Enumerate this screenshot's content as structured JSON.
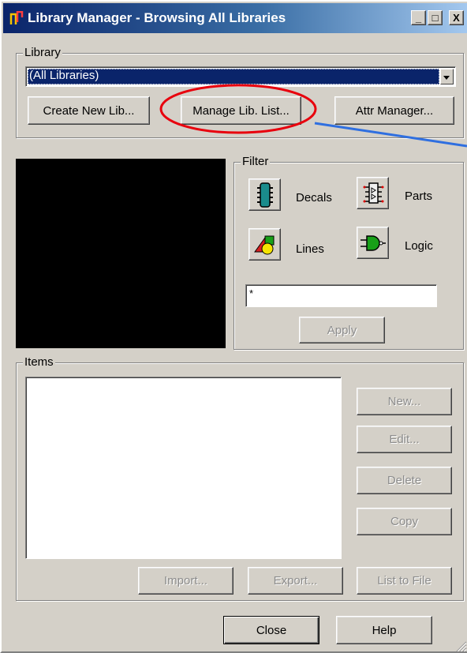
{
  "window": {
    "title": "Library Manager - Browsing All Libraries",
    "minimize": "_",
    "restore": "□",
    "close": "X"
  },
  "library": {
    "group_label": "Library",
    "selected": "(All Libraries)",
    "create_new_lib": "Create New Lib...",
    "manage_lib_list": "Manage Lib. List...",
    "attr_manager": "Attr Manager..."
  },
  "filter": {
    "group_label": "Filter",
    "decals": "Decals",
    "parts": "Parts",
    "lines": "Lines",
    "logic": "Logic",
    "pattern": "*",
    "apply": "Apply"
  },
  "items": {
    "group_label": "Items",
    "new": "New...",
    "edit": "Edit...",
    "delete": "Delete",
    "copy": "Copy",
    "import": "Import...",
    "export": "Export...",
    "list_to_file": "List to File"
  },
  "footer": {
    "close": "Close",
    "help": "Help"
  },
  "colors": {
    "annotation_circle": "#e8000d",
    "annotation_arrow": "#2f6fe0",
    "selection": "#0a246a",
    "dialog_face": "#d4d0c8"
  },
  "icons": [
    "app-logo-icon",
    "decals-icon",
    "parts-icon",
    "lines-icon",
    "logic-icon",
    "dropdown-arrow-icon",
    "resize-grip-icon"
  ]
}
